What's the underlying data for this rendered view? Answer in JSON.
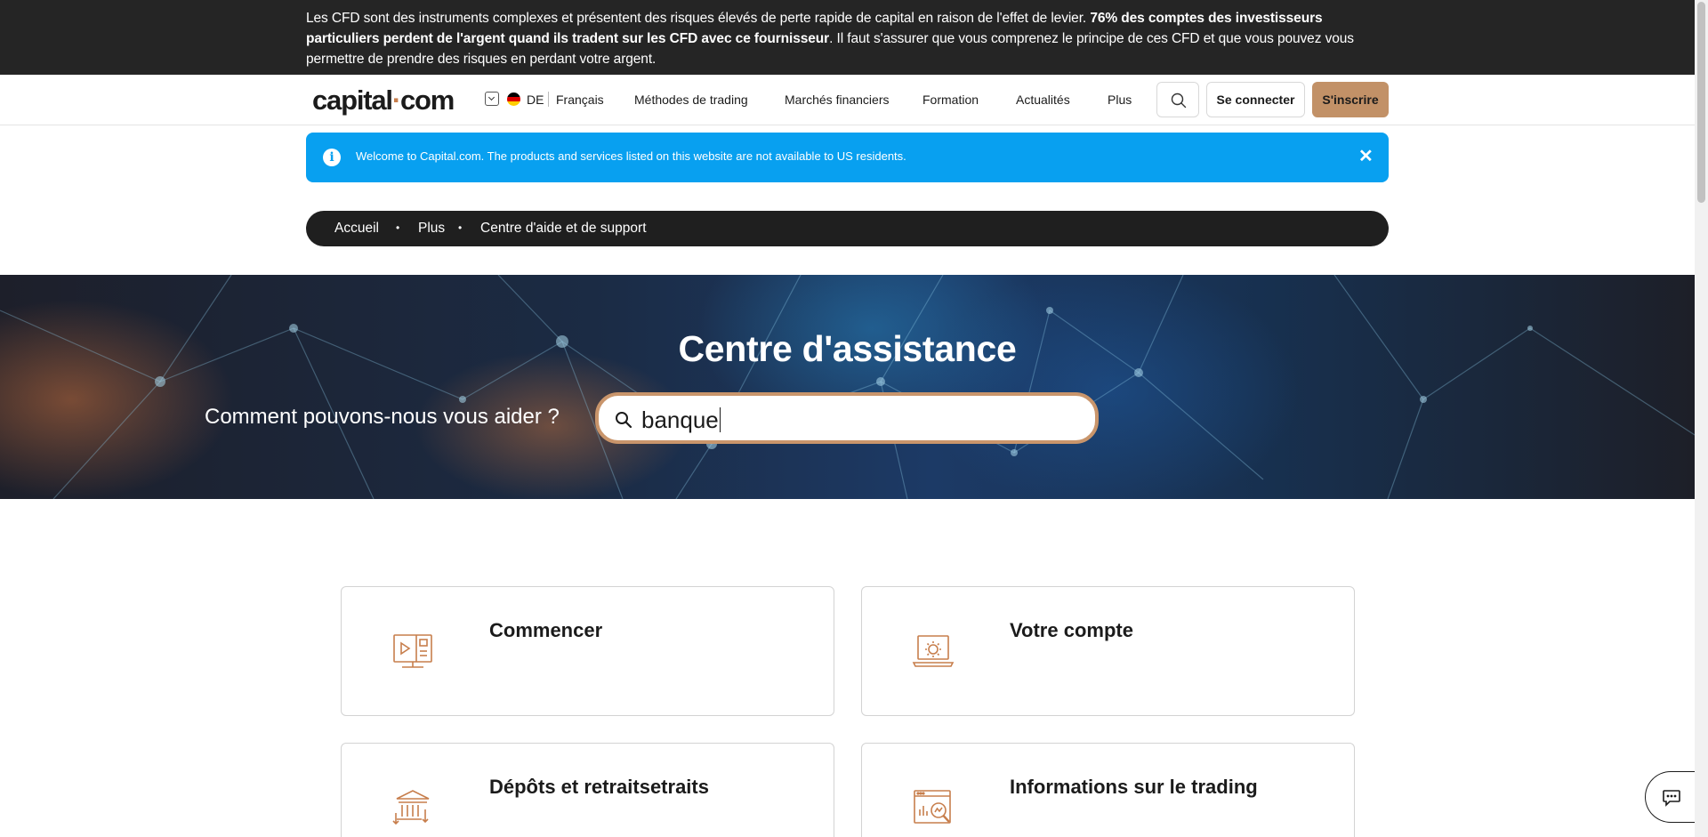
{
  "risk_warning": {
    "text_start": "Les CFD sont des instruments complexes et présentent des risques élevés de perte rapide de capital en raison de l'effet de levier. ",
    "text_bold": "76% des comptes des investisseurs particuliers perdent de l'argent quand ils tradent sur les CFD avec ce fournisseur",
    "text_end": ". Il faut s'assurer que vous comprenez le principe de ces CFD et que vous pouvez vous permettre de prendre des risques en perdant votre argent."
  },
  "header": {
    "logo_left": "capital",
    "logo_dot": "·",
    "logo_right": "com",
    "language_code": "DE",
    "language_name": "Français",
    "nav": [
      "Méthodes de trading",
      "Marchés financiers",
      "Formation",
      "Actualités",
      "Plus"
    ],
    "login_label": "Se connecter",
    "signup_label": "S'inscrire"
  },
  "notice": {
    "info_glyph": "i",
    "message": "Welcome to Capital.com. The products and services listed on this website are not available to US residents.",
    "close_glyph": "✕"
  },
  "breadcrumb": {
    "items": [
      "Accueil",
      "Plus",
      "Centre d'aide et de support"
    ],
    "separator": "•"
  },
  "hero": {
    "title": "Centre d'assistance",
    "prompt": "Comment pouvons-nous vous aider ?",
    "search_value": "banque"
  },
  "cards": [
    {
      "title": "Commencer",
      "icon": "presentation-screen-icon"
    },
    {
      "title": "Votre compte",
      "icon": "laptop-gear-icon"
    },
    {
      "title": "Dépôts et retraitsetraits",
      "icon": "bank-icon"
    },
    {
      "title": "Informations sur le trading",
      "icon": "chart-magnifier-icon"
    }
  ],
  "colors": {
    "accent": "#c29167",
    "icon": "#c77e4c",
    "notice": "#08a0f0",
    "dark": "#252525"
  }
}
